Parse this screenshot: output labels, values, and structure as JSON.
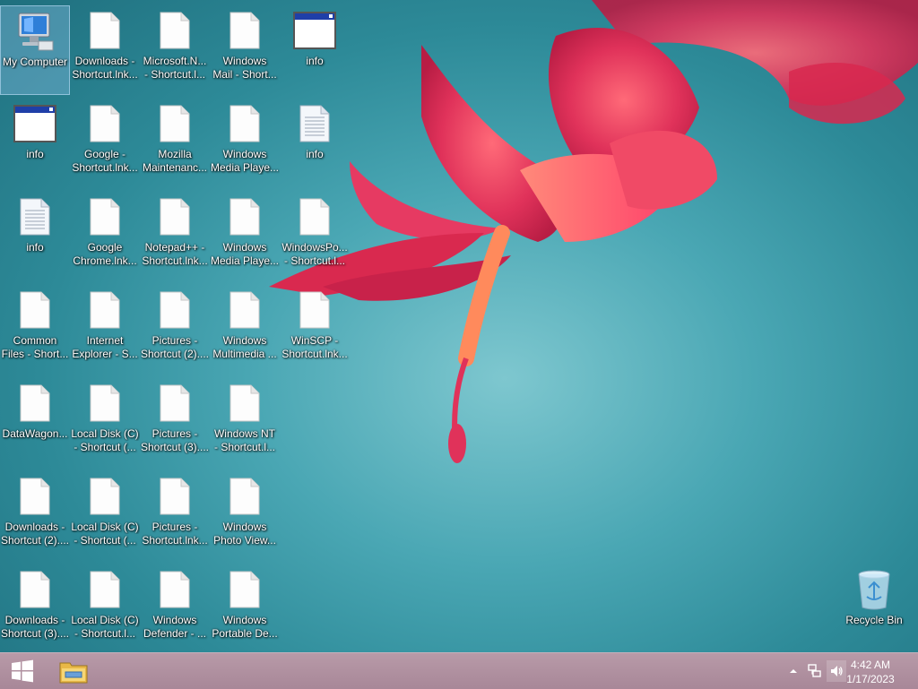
{
  "desktop": {
    "icons": [
      {
        "l1": "My Computer",
        "l2": ""
      },
      {
        "l1": "Downloads -",
        "l2": "Shortcut.lnk..."
      },
      {
        "l1": "Microsoft.N...",
        "l2": "- Shortcut.l..."
      },
      {
        "l1": "Windows",
        "l2": "Mail - Short..."
      },
      {
        "l1": "info",
        "l2": ""
      },
      {
        "l1": "info",
        "l2": ""
      },
      {
        "l1": "Google -",
        "l2": "Shortcut.lnk..."
      },
      {
        "l1": "Mozilla",
        "l2": "Maintenanc..."
      },
      {
        "l1": "Windows",
        "l2": "Media Playe..."
      },
      {
        "l1": "info",
        "l2": ""
      },
      {
        "l1": "info",
        "l2": ""
      },
      {
        "l1": "Google",
        "l2": "Chrome.lnk..."
      },
      {
        "l1": "Notepad++ -",
        "l2": "Shortcut.lnk..."
      },
      {
        "l1": "Windows",
        "l2": "Media Playe..."
      },
      {
        "l1": "WindowsPo...",
        "l2": "- Shortcut.l..."
      },
      {
        "l1": "Common",
        "l2": "Files - Short..."
      },
      {
        "l1": "Internet",
        "l2": "Explorer - S..."
      },
      {
        "l1": "Pictures -",
        "l2": "Shortcut (2)...."
      },
      {
        "l1": "Windows",
        "l2": "Multimedia ..."
      },
      {
        "l1": "WinSCP -",
        "l2": "Shortcut.lnk..."
      },
      {
        "l1": "DataWagon...",
        "l2": ""
      },
      {
        "l1": "Local Disk (C)",
        "l2": "- Shortcut (..."
      },
      {
        "l1": "Pictures -",
        "l2": "Shortcut (3)...."
      },
      {
        "l1": "Windows NT",
        "l2": "- Shortcut.l..."
      },
      {
        "l1": "Downloads -",
        "l2": "Shortcut (2)...."
      },
      {
        "l1": "Local Disk (C)",
        "l2": "- Shortcut (..."
      },
      {
        "l1": "Pictures -",
        "l2": "Shortcut.lnk..."
      },
      {
        "l1": "Windows",
        "l2": "Photo View..."
      },
      {
        "l1": "Downloads -",
        "l2": "Shortcut (3)...."
      },
      {
        "l1": "Local Disk (C)",
        "l2": "- Shortcut.l..."
      },
      {
        "l1": "Windows",
        "l2": "Defender - ..."
      },
      {
        "l1": "Windows",
        "l2": "Portable De..."
      },
      {
        "l1": "Recycle Bin",
        "l2": ""
      }
    ]
  },
  "taskbar": {
    "clock_time": "4:42 AM",
    "clock_date": "1/17/2023"
  },
  "colors": {
    "wallpaper_teal": "#4aa7b4",
    "taskbar": "#b08fa0",
    "flower": "#e0325a"
  }
}
